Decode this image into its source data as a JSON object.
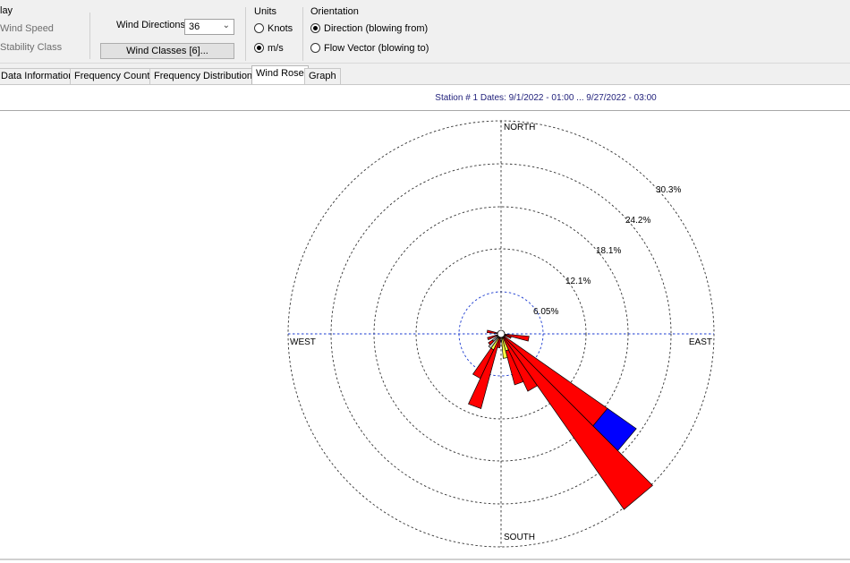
{
  "display": {
    "group_label": "lay",
    "wind_speed_label": "Wind Speed",
    "stability_class_label": "Stability Class"
  },
  "controls": {
    "wind_directions_label": "Wind Directions:",
    "wind_directions_value": "36",
    "wind_classes_button": "Wind Classes [6]..."
  },
  "units": {
    "group_label": "Units",
    "knots_label": "Knots",
    "ms_label": "m/s",
    "selected": "m/s"
  },
  "orientation": {
    "group_label": "Orientation",
    "direction_label": "Direction (blowing from)",
    "flow_label": "Flow Vector (blowing to)",
    "selected": "direction"
  },
  "tabs": [
    {
      "label": "Data Information",
      "active": false
    },
    {
      "label": "Frequency Count",
      "active": false
    },
    {
      "label": "Frequency Distribution",
      "active": false
    },
    {
      "label": "Wind Rose",
      "active": true
    },
    {
      "label": "Graph",
      "active": false
    }
  ],
  "header": {
    "station_text": "Station #   1  Dates: 9/1/2022 - 01:00 ... 9/27/2022 - 03:00"
  },
  "chart_data": {
    "type": "wind_rose",
    "title": "Station #   1  Dates: 9/1/2022 - 01:00 ... 9/27/2022 - 03:00",
    "ring_labels": [
      "6.05%",
      "12.1%",
      "18.1%",
      "24.2%",
      "30.3%"
    ],
    "ring_values": [
      6.05,
      12.1,
      18.1,
      24.2,
      30.3
    ],
    "cardinals": {
      "north": "NORTH",
      "south": "SOUTH",
      "east": "EAST",
      "west": "WEST"
    },
    "sector_width_deg": 10,
    "colors": {
      "red": "#ff0000",
      "blue": "#0000ff",
      "yellow": "#ffff44",
      "gray": "#c8c8c8"
    },
    "petals": [
      {
        "direction_deg": 140,
        "segments": [
          {
            "color": "red",
            "upto": 30.5
          }
        ]
      },
      {
        "direction_deg": 130,
        "segments": [
          {
            "color": "red",
            "upto": 18.5
          },
          {
            "color": "blue",
            "upto": 23.5
          }
        ]
      },
      {
        "direction_deg": 150,
        "segments": [
          {
            "color": "red",
            "upto": 9.0
          }
        ]
      },
      {
        "direction_deg": 160,
        "segments": [
          {
            "color": "yellow",
            "upto": 2.5
          },
          {
            "color": "red",
            "upto": 7.5
          }
        ]
      },
      {
        "direction_deg": 170,
        "segments": [
          {
            "color": "yellow",
            "upto": 3.5
          }
        ]
      },
      {
        "direction_deg": 190,
        "segments": [
          {
            "color": "red",
            "upto": 2.0
          }
        ]
      },
      {
        "direction_deg": 200,
        "segments": [
          {
            "color": "red",
            "upto": 11.0
          }
        ]
      },
      {
        "direction_deg": 210,
        "segments": [
          {
            "color": "yellow",
            "upto": 2.5
          },
          {
            "color": "red",
            "upto": 7.0
          }
        ]
      },
      {
        "direction_deg": 220,
        "segments": [
          {
            "color": "gray",
            "upto": 2.5
          }
        ]
      },
      {
        "direction_deg": 230,
        "segments": [
          {
            "color": "gray",
            "upto": 1.5
          },
          {
            "color": "red",
            "upto": 2.2
          }
        ]
      },
      {
        "direction_deg": 250,
        "segments": [
          {
            "color": "red",
            "upto": 2.0
          }
        ]
      },
      {
        "direction_deg": 280,
        "segments": [
          {
            "color": "red",
            "upto": 2.0
          }
        ]
      },
      {
        "direction_deg": 100,
        "segments": [
          {
            "color": "red",
            "upto": 4.0
          }
        ]
      },
      {
        "direction_deg": 110,
        "segments": [
          {
            "color": "red",
            "upto": 1.5
          }
        ]
      }
    ]
  }
}
